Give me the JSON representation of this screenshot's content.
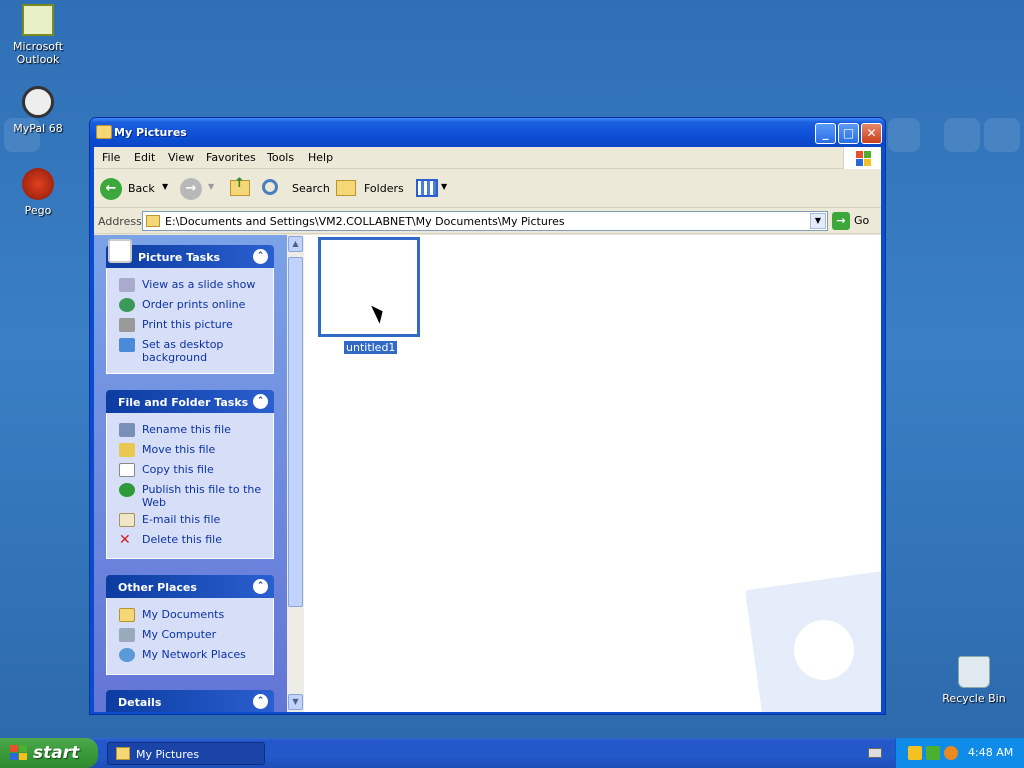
{
  "desktop": {
    "icons": [
      {
        "label": "Microsoft Outlook"
      },
      {
        "label": "MyPal 68"
      },
      {
        "label": "Pego"
      },
      {
        "label": "Recycle Bin"
      }
    ]
  },
  "window": {
    "title": "My Pictures",
    "menu": [
      "File",
      "Edit",
      "View",
      "Favorites",
      "Tools",
      "Help"
    ],
    "toolbar": {
      "back": "Back",
      "search": "Search",
      "folders": "Folders"
    },
    "address": {
      "label": "Address",
      "value": "E:\\Documents and Settings\\VM2.COLLABNET\\My Documents\\My Pictures",
      "go": "Go"
    },
    "taskpane": {
      "picture_tasks": {
        "title": "Picture Tasks",
        "items": [
          "View as a slide show",
          "Order prints online",
          "Print this picture",
          "Set as desktop background"
        ]
      },
      "file_folder_tasks": {
        "title": "File and Folder Tasks",
        "items": [
          "Rename this file",
          "Move this file",
          "Copy this file",
          "Publish this file to the Web",
          "E-mail this file",
          "Delete this file"
        ]
      },
      "other_places": {
        "title": "Other Places",
        "items": [
          "My Documents",
          "My Computer",
          "My Network Places"
        ]
      },
      "details": {
        "title": "Details"
      }
    },
    "files": [
      {
        "name": "untitled1",
        "selected": true
      }
    ]
  },
  "taskbar": {
    "start": "start",
    "tasks": [
      {
        "label": "My Pictures"
      }
    ],
    "clock": "4:48 AM"
  },
  "colors": {
    "desktop": "#3a7fc4",
    "titlebar": "#0d4fd6",
    "selection": "#316ac5",
    "start": "#3c9d3c"
  }
}
